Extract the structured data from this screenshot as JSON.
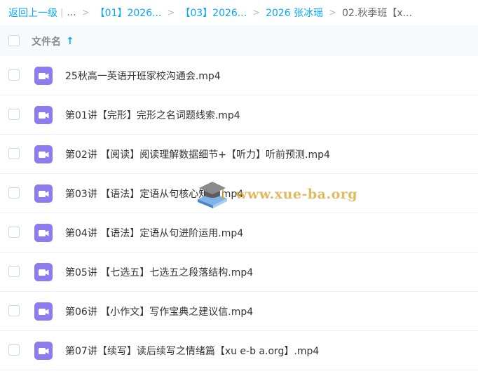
{
  "breadcrumb": {
    "back_label": "返回上一级",
    "separator": "|",
    "ellipsis": "...",
    "arrow": ">",
    "items": [
      "【01】2026...",
      "【03】2026...",
      "2026 张冰瑶"
    ],
    "current": "02.秋季班【x..."
  },
  "header": {
    "column_name": "文件名",
    "sort_arrow": "↑"
  },
  "files": [
    {
      "name": "25秋高一英语开班家校沟通会.mp4"
    },
    {
      "name": "第01讲【完形】完形之名词题线索.mp4"
    },
    {
      "name": "第02讲 【阅读】阅读理解数据细节+【听力】听前预测.mp4"
    },
    {
      "name": "第03讲 【语法】定语从句核心知识.mp4"
    },
    {
      "name": "第04讲 【语法】定语从句进阶运用.mp4"
    },
    {
      "name": "第05讲 【七选五】七选五之段落结构.mp4"
    },
    {
      "name": "第06讲 【小作文】写作宝典之建议信.mp4"
    },
    {
      "name": "第07讲【续写】读后续写之情绪篇【xu e-b a.org】.mp4"
    }
  ],
  "watermark": {
    "text": "www.xue-ba.org"
  },
  "colors": {
    "accent": "#06a7ff",
    "video_icon": "#8c7cf0",
    "header_bg": "#f7fafd"
  },
  "icons": {
    "file": "video-file-icon",
    "watermark": "graduation-cap-icon"
  }
}
